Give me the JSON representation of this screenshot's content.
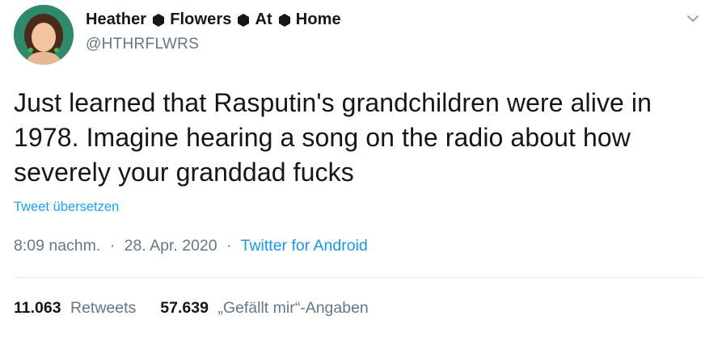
{
  "author": {
    "name_parts": [
      "Heather",
      "Flowers",
      "At",
      "Home"
    ],
    "separator_icon": "black-hexagon-icon",
    "handle": "@HTHRFLWRS",
    "avatar_icon": "avatar-illustration"
  },
  "menu": {
    "chevron_icon": "chevron-down-icon"
  },
  "tweet": {
    "text": "Just learned that Rasputin's grandchildren were alive in 1978. Imagine hearing a song on the radio about how severely your granddad fucks",
    "translate_label": "Tweet übersetzen",
    "time": "8:09 nachm.",
    "date": "28. Apr. 2020",
    "dot": "·",
    "source": "Twitter for Android"
  },
  "stats": {
    "retweets_count": "11.063",
    "retweets_label": "Retweets",
    "likes_count": "57.639",
    "likes_label": "„Gefällt mir“-Angaben"
  },
  "colors": {
    "link_blue": "#1da1f2",
    "secondary_text": "#657786",
    "primary_text": "#14171a",
    "divider": "#e6ecf0",
    "avatar_bg": "#3b8a6e"
  }
}
